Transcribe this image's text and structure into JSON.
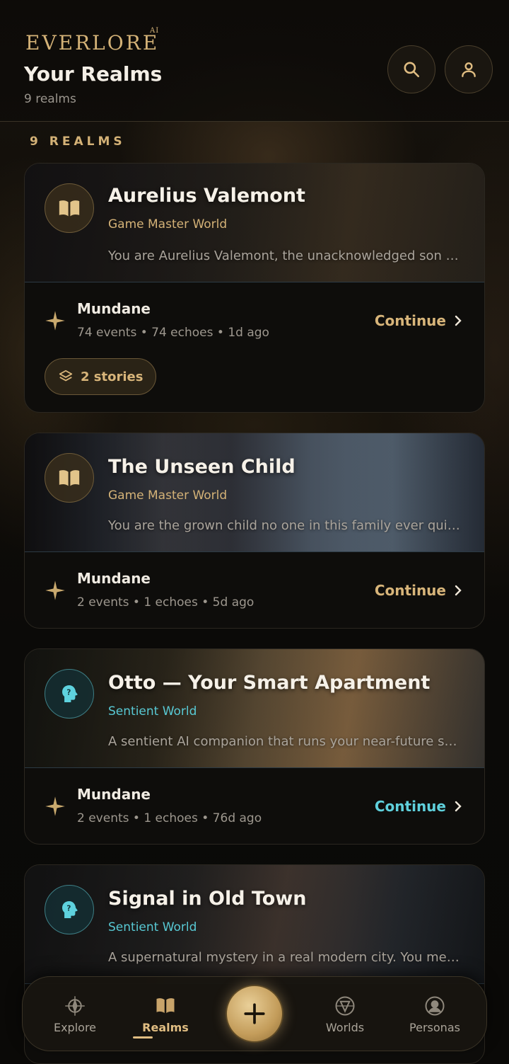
{
  "app": {
    "logo": "EVERLORE",
    "logo_sup": "AI"
  },
  "header": {
    "title": "Your Realms",
    "subtitle": "9 realms",
    "search_icon": "search-icon",
    "profile_icon": "user-icon"
  },
  "section_label": "9 REALMS",
  "realms": [
    {
      "title": "Aurelius Valemont",
      "type": "Game Master World",
      "description": "You are Aurelius Valemont, the unacknowledged son of a noble house.",
      "accent": "#d4b277",
      "story": {
        "name": "Mundane",
        "meta": "74 events • 74 echoes • 1d ago"
      },
      "continue_label": "Continue",
      "stories_pill": "2 stories"
    },
    {
      "title": "The Unseen Child",
      "type": "Game Master World",
      "description": "You are the grown child no one in this family ever quite noticed.",
      "accent": "#d4b277",
      "story": {
        "name": "Mundane",
        "meta": "2 events • 1 echoes • 5d ago"
      },
      "continue_label": "Continue"
    },
    {
      "title": "Otto — Your Smart Apartment",
      "type": "Sentient World",
      "description": "A sentient AI companion that runs your near-future smart apartment.",
      "accent": "#58c9d4",
      "story": {
        "name": "Mundane",
        "meta": "2 events • 1 echoes • 76d ago"
      },
      "continue_label": "Continue"
    },
    {
      "title": "Signal in Old Town",
      "type": "Sentient World",
      "description": "A supernatural mystery in a real modern city. You message a stranger.",
      "accent": "#58c9d4"
    }
  ],
  "nav": {
    "items": [
      {
        "label": "Explore",
        "icon": "compass-icon"
      },
      {
        "label": "Realms",
        "icon": "book-icon",
        "active": true
      },
      {
        "label": "Worlds",
        "icon": "globe-icon"
      },
      {
        "label": "Personas",
        "icon": "persona-icon"
      }
    ],
    "fab_icon": "plus-icon"
  }
}
